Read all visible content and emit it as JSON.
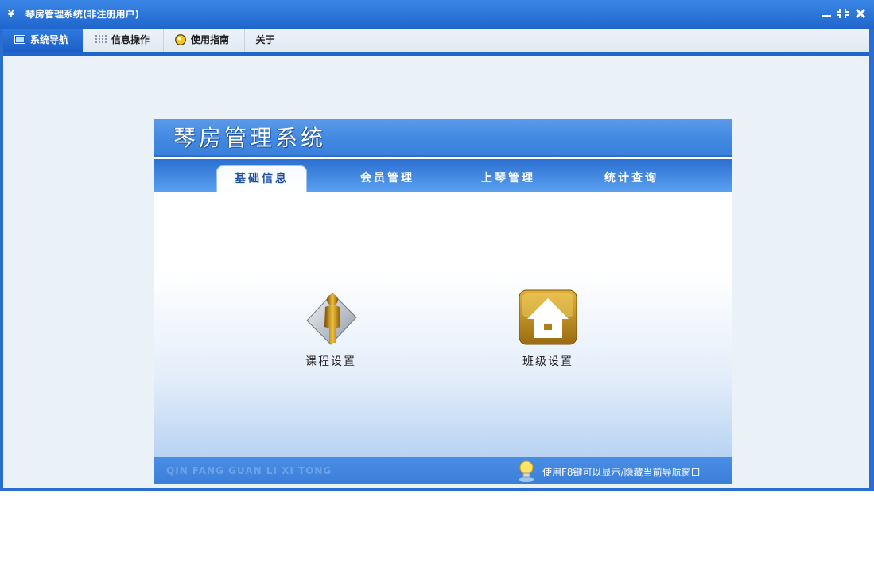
{
  "window": {
    "title": "琴房管理系统(非注册用户)",
    "icon": "app-icon",
    "controls": [
      "minimize-icon",
      "restore-icon",
      "close-icon"
    ]
  },
  "menubar": {
    "tabs": [
      {
        "label": "系统导航",
        "icon": "monitor-icon",
        "active": true
      },
      {
        "label": "信息操作",
        "icon": "grid-icon",
        "active": false
      },
      {
        "label": "使用指南",
        "icon": "help-circle-icon",
        "active": false
      },
      {
        "label": "关于",
        "icon": "",
        "active": false
      }
    ]
  },
  "panel": {
    "title": "琴房管理系统",
    "tabs": [
      {
        "label": "基础信息",
        "active": true
      },
      {
        "label": "会员管理",
        "active": false
      },
      {
        "label": "上琴管理",
        "active": false
      },
      {
        "label": "统计查询",
        "active": false
      }
    ],
    "features": [
      {
        "label": "课程设置",
        "icon": "person-document-icon"
      },
      {
        "label": "班级设置",
        "icon": "house-icon"
      }
    ],
    "footer": {
      "brand": "QIN FANG GUAN LI XI TONG",
      "hint": "使用F8键可以显示/隐藏当前导航窗口",
      "hint_icon": "lightbulb-icon"
    }
  },
  "colors": {
    "titlebar": "#2a6fd0",
    "accent": "#1f66cc",
    "active_tab_text": "#1a4fa3"
  }
}
